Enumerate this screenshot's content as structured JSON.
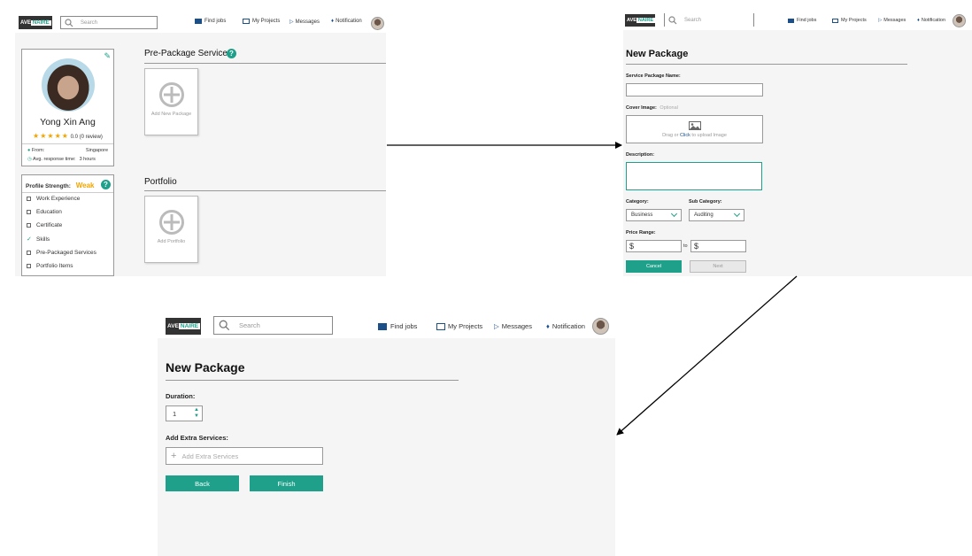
{
  "nav": {
    "logo_ave": "AVE",
    "logo_naire": "NAIRE",
    "search_placeholder": "Search",
    "find_jobs": "Find jobs",
    "my_projects": "My Projects",
    "messages": "Messages",
    "notification": "Notification"
  },
  "profile": {
    "name": "Yong Xin Ang",
    "rating": "0.0 (0 review)",
    "stars": 5,
    "from_label": "From:",
    "from_value": "Singapore",
    "response_label": "Avg. response time:",
    "response_value": "3 hours",
    "strength_label": "Profile Strength:",
    "strength_value": "Weak",
    "checklist": [
      {
        "label": "Work Experience",
        "checked": false
      },
      {
        "label": "Education",
        "checked": false
      },
      {
        "label": "Certificate",
        "checked": false
      },
      {
        "label": "Skills",
        "checked": true
      },
      {
        "label": "Pre-Packaged Services",
        "checked": false
      },
      {
        "label": "Portfolio Items",
        "checked": false
      }
    ]
  },
  "sections": {
    "pre_package_title": "Pre-Package Service",
    "add_package": "Add New Package",
    "portfolio_title": "Portfolio",
    "add_portfolio": "Add Portfolio"
  },
  "new_package_1": {
    "title": "New Package",
    "name_label": "Service Package Name:",
    "cover_label": "Cover Image:",
    "cover_optional": "Optional",
    "upload_pre": "Drag or ",
    "upload_click": "Click",
    "upload_post": " to upload Image",
    "description_label": "Description:",
    "category_label": "Category:",
    "category_value": "Business",
    "subcategory_label": "Sub Category:",
    "subcategory_value": "Auditing",
    "price_label": "Price Range:",
    "currency": "$",
    "to": "to",
    "cancel": "Cancel",
    "next": "Next"
  },
  "new_package_2": {
    "title": "New Package",
    "duration_label": "Duration:",
    "duration_value": "1",
    "extra_label": "Add Extra Services:",
    "extra_placeholder": "Add Extra Services",
    "back": "Back",
    "finish": "Finish"
  },
  "colors": {
    "accent": "#1ea08a",
    "warning": "#f0a500",
    "panel_bg": "#f4f5f4"
  }
}
